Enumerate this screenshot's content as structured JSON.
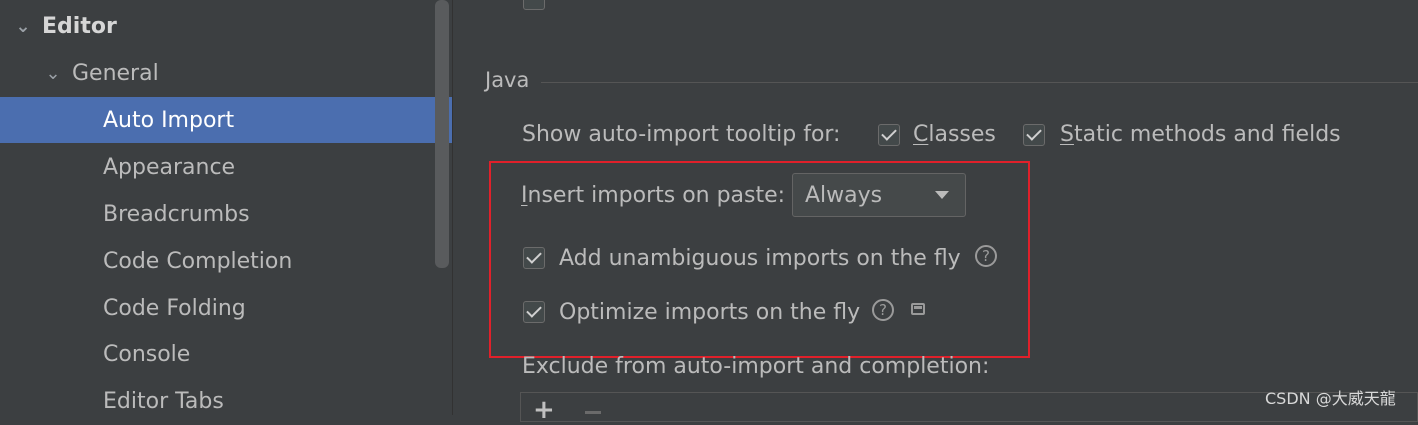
{
  "sidebar": {
    "items": [
      {
        "label": "Editor",
        "level": 0,
        "expanded": true,
        "selected": false
      },
      {
        "label": "General",
        "level": 1,
        "expanded": true,
        "selected": false
      },
      {
        "label": "Auto Import",
        "level": 2,
        "selected": true
      },
      {
        "label": "Appearance",
        "level": 2,
        "selected": false
      },
      {
        "label": "Breadcrumbs",
        "level": 2,
        "selected": false
      },
      {
        "label": "Code Completion",
        "level": 2,
        "selected": false
      },
      {
        "label": "Code Folding",
        "level": 2,
        "selected": false
      },
      {
        "label": "Console",
        "level": 2,
        "selected": false
      },
      {
        "label": "Editor Tabs",
        "level": 2,
        "selected": false
      }
    ],
    "icons": {
      "expanded": "chevron-down-icon"
    }
  },
  "java_section": {
    "title": "Java",
    "tooltip_label": "Show auto-import tooltip for:",
    "classes_label": "Classes",
    "classes_checked": true,
    "static_label": "Static methods and fields",
    "static_checked": true,
    "insert_label": "Insert imports on paste:",
    "insert_value": "Always",
    "add_unambiguous_label": "Add unambiguous imports on the fly",
    "add_unambiguous_checked": true,
    "optimize_label": "Optimize imports on the fly",
    "optimize_checked": true,
    "exclude_label": "Exclude from auto-import and completion:",
    "add_button": "+"
  },
  "watermark": "CSDN @大威天龍",
  "colors": {
    "background": "#3c3f41",
    "selection": "#4b6eaf",
    "highlight_box": "#e0202a",
    "text": "#bbbbbb"
  }
}
